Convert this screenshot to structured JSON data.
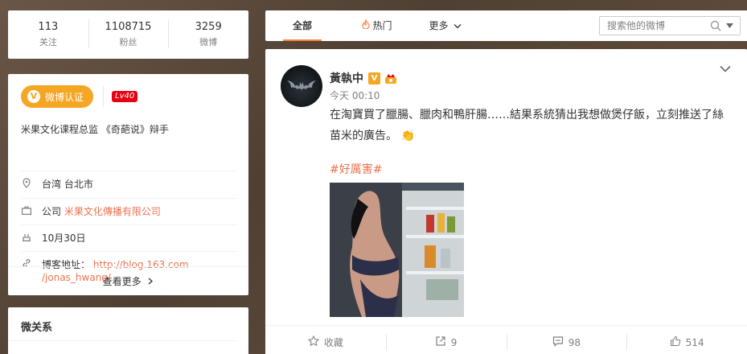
{
  "stats": [
    {
      "count": "113",
      "label": "关注"
    },
    {
      "count": "1108715",
      "label": "粉丝"
    },
    {
      "count": "3259",
      "label": "微博"
    }
  ],
  "profile": {
    "verify_label": "微博认证",
    "verify_icon_letter": "V",
    "level": "Lv40",
    "description": "米果文化课程总监 《奇葩说》辩手",
    "location": "台湾 台北市",
    "company_prefix": "公司",
    "company_name": "米果文化傳播有限公司",
    "birthday": "10月30日",
    "blog_label": "博客地址：",
    "blog_url_line1": "http://blog.163.com",
    "blog_url_line2": "/jonas_hwang/",
    "more_label": "查看更多"
  },
  "relations": {
    "title": "微关系"
  },
  "tabs": {
    "all": "全部",
    "hot": "热门",
    "more": "更多",
    "search_placeholder": "搜索他的微博"
  },
  "post": {
    "author": "黃執中",
    "v_badge": "V",
    "time": "今天 00:10",
    "text": "在淘寶買了臘腸、臘肉和鴨肝腸……結果系統猜出我想做煲仔飯，立刻推送了絲苗米的廣告。",
    "emoji": "👏",
    "hashtag": "#好厲害#",
    "actions": {
      "collect": "收藏",
      "repost": "9",
      "comment": "98",
      "like": "514"
    }
  },
  "colors": {
    "accent": "#ff8140",
    "verify": "#f5a623",
    "link": "#eb7350",
    "level": "#e60012"
  },
  "icons": [
    "location-icon",
    "briefcase-icon",
    "cake-icon",
    "link-icon",
    "fire-icon",
    "search-icon",
    "chevron-down-icon",
    "star-icon",
    "repost-icon",
    "comment-icon",
    "like-icon",
    "crown-icon"
  ]
}
